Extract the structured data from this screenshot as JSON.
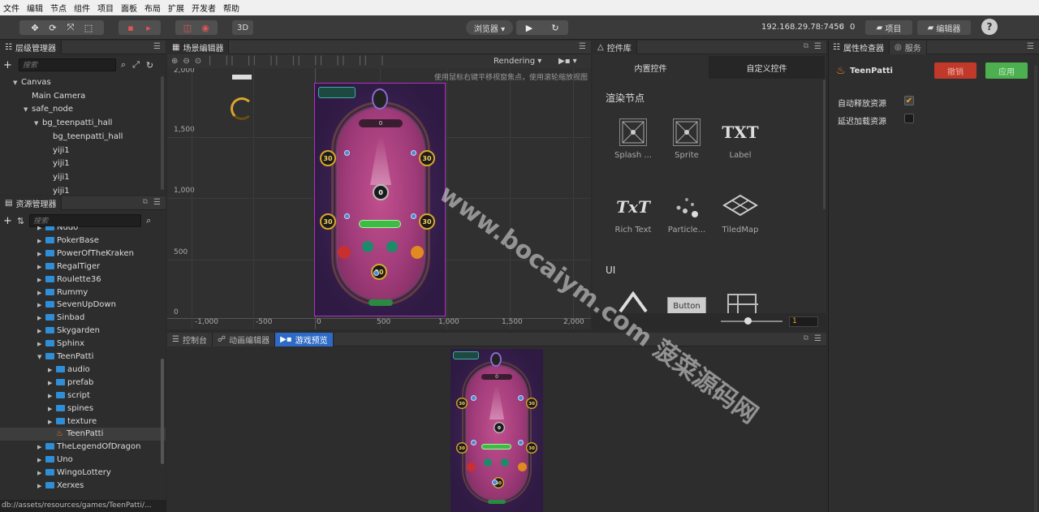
{
  "menu": [
    "文件",
    "编辑",
    "节点",
    "组件",
    "项目",
    "面板",
    "布局",
    "扩展",
    "开发者",
    "帮助"
  ],
  "toolbar": {
    "mode_3d": "3D",
    "browser_label": "浏览器 ▾",
    "ip": "192.168.29.78:7456",
    "wifi_count": "0",
    "project_btn": "项目",
    "editor_btn": "编辑器",
    "help_btn": "?"
  },
  "hierarchy": {
    "title": "层级管理器",
    "search_placeholder": "搜索",
    "items": [
      {
        "label": "Canvas",
        "indent": 0,
        "arrow": "▼"
      },
      {
        "label": "Main Camera",
        "indent": 1,
        "arrow": ""
      },
      {
        "label": "safe_node",
        "indent": 1,
        "arrow": "▼"
      },
      {
        "label": "bg_teenpatti_hall",
        "indent": 2,
        "arrow": "▼"
      },
      {
        "label": "bg_teenpatti_hall",
        "indent": 3,
        "arrow": ""
      },
      {
        "label": "yiji1",
        "indent": 3,
        "arrow": ""
      },
      {
        "label": "yiji1",
        "indent": 3,
        "arrow": ""
      },
      {
        "label": "yiji1",
        "indent": 3,
        "arrow": ""
      },
      {
        "label": "yiji1",
        "indent": 3,
        "arrow": ""
      }
    ]
  },
  "assets": {
    "title": "资源管理器",
    "search_placeholder": "搜索",
    "items": [
      {
        "label": "Nudo",
        "indent": 0,
        "type": "folder",
        "arrow": "▶"
      },
      {
        "label": "PokerBase",
        "indent": 0,
        "type": "folder",
        "arrow": "▶"
      },
      {
        "label": "PowerOfTheKraken",
        "indent": 0,
        "type": "folder",
        "arrow": "▶"
      },
      {
        "label": "RegalTiger",
        "indent": 0,
        "type": "folder",
        "arrow": "▶"
      },
      {
        "label": "Roulette36",
        "indent": 0,
        "type": "folder",
        "arrow": "▶"
      },
      {
        "label": "Rummy",
        "indent": 0,
        "type": "folder",
        "arrow": "▶"
      },
      {
        "label": "SevenUpDown",
        "indent": 0,
        "type": "folder",
        "arrow": "▶"
      },
      {
        "label": "Sinbad",
        "indent": 0,
        "type": "folder",
        "arrow": "▶"
      },
      {
        "label": "Skygarden",
        "indent": 0,
        "type": "folder",
        "arrow": "▶"
      },
      {
        "label": "Sphinx",
        "indent": 0,
        "type": "folder",
        "arrow": "▶"
      },
      {
        "label": "TeenPatti",
        "indent": 0,
        "type": "folder",
        "arrow": "▼"
      },
      {
        "label": "audio",
        "indent": 1,
        "type": "folder",
        "arrow": "▶"
      },
      {
        "label": "prefab",
        "indent": 1,
        "type": "folder",
        "arrow": "▶"
      },
      {
        "label": "script",
        "indent": 1,
        "type": "folder",
        "arrow": "▶"
      },
      {
        "label": "spines",
        "indent": 1,
        "type": "folder",
        "arrow": "▶"
      },
      {
        "label": "texture",
        "indent": 1,
        "type": "folder",
        "arrow": "▶"
      },
      {
        "label": "TeenPatti",
        "indent": 1,
        "type": "scene",
        "arrow": ""
      },
      {
        "label": "TheLegendOfDragon",
        "indent": 0,
        "type": "folder",
        "arrow": "▶"
      },
      {
        "label": "Uno",
        "indent": 0,
        "type": "folder",
        "arrow": "▶"
      },
      {
        "label": "WingoLottery",
        "indent": 0,
        "type": "folder",
        "arrow": "▶"
      },
      {
        "label": "Xerxes",
        "indent": 0,
        "type": "folder",
        "arrow": "▶"
      }
    ]
  },
  "status_path": "db://assets/resources/games/TeenPatti/...",
  "scene": {
    "title": "场景编辑器",
    "hint": "使用鼠标右键平移视窗焦点，使用滚轮缩放视图",
    "rendering": "Rendering",
    "y_ticks": [
      "2,000",
      "1,500",
      "1,000",
      "500",
      "0"
    ],
    "x_ticks": [
      "-1,000",
      "-500",
      "0",
      "500",
      "1,000",
      "1,500",
      "2,000"
    ]
  },
  "library": {
    "title": "控件库",
    "tab_builtin": "内置控件",
    "tab_custom": "自定义控件",
    "section_render": "渲染节点",
    "section_ui": "UI",
    "nodes": [
      "Splash ...",
      "Sprite",
      "Label",
      "Rich Text",
      "Particle...",
      "TiledMap"
    ],
    "label_glyph": "TXT",
    "richtext_glyph": "TxT",
    "button_glyph": "Button",
    "zoom_value": "1"
  },
  "bottom": {
    "tab_console": "控制台",
    "tab_anim": "动画编辑器",
    "tab_preview": "游戏预览"
  },
  "inspector": {
    "title": "属性检查器",
    "tab_service": "服务",
    "node_name": "TeenPatti",
    "revert": "撤销",
    "apply": "应用",
    "auto_release": "自动释放资源",
    "auto_release_checked": true,
    "lazy_load": "延迟加载资源",
    "lazy_load_checked": false
  },
  "game": {
    "chip_value": "30",
    "center_value": "0",
    "top_value": "0"
  },
  "watermark": "www.bocaiym.com 菠菜源码网",
  "colors": {
    "accent_blue": "#2e6bc7",
    "folder_blue": "#2e8fd8",
    "table_pink": "#b0407e",
    "revert_red": "#c0392b",
    "apply_green": "#4caf50"
  }
}
